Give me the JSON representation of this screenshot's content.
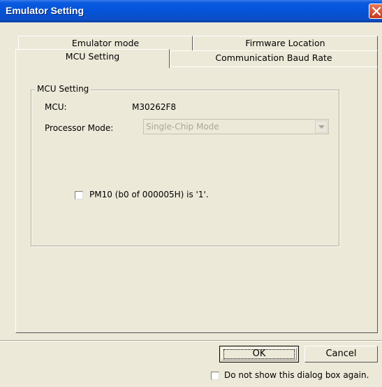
{
  "window": {
    "title": "Emulator Setting"
  },
  "tabs": {
    "back_row": [
      "Emulator mode",
      "Firmware Location"
    ],
    "front_row": [
      "MCU Setting",
      "Communication Baud Rate"
    ],
    "selected": "MCU Setting"
  },
  "mcu_group": {
    "title": "MCU Setting",
    "mcu_label": "MCU:",
    "mcu_value": "M30262F8",
    "processor_mode_label": "Processor Mode:",
    "processor_mode_value": "Single-Chip Mode",
    "processor_mode_enabled": false,
    "pm10_checkbox_label": "PM10 (b0 of 000005H) is '1'.",
    "pm10_checked": false
  },
  "buttons": {
    "ok": "OK",
    "cancel": "Cancel"
  },
  "footer": {
    "dont_show_label": "Do not show this dialog box again.",
    "dont_show_checked": false
  },
  "icons": {
    "close": "close-icon",
    "dropdown": "chevron-down-icon"
  },
  "colors": {
    "titlebar": "#0453d8",
    "close_button": "#d9532f",
    "dialog_bg": "#ece9d8"
  }
}
